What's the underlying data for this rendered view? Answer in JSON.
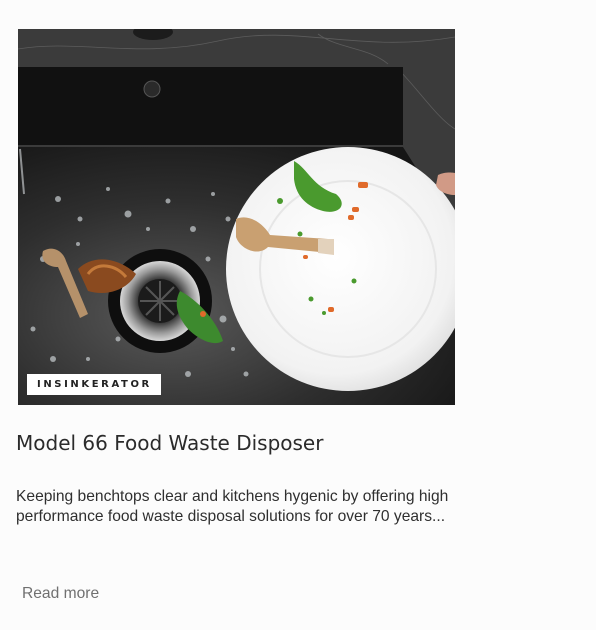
{
  "card": {
    "brand": "INSINKERATOR",
    "title": "Model 66 Food Waste Disposer",
    "description": "Keeping benchtops clear and kitchens hygenic by offering high performance food waste disposal solutions for over 70 years...",
    "read_more": "Read more"
  },
  "colors": {
    "background": "#fcfcfc",
    "text": "#2b2b2b",
    "link": "#707070",
    "tag_bg": "#ffffff"
  }
}
